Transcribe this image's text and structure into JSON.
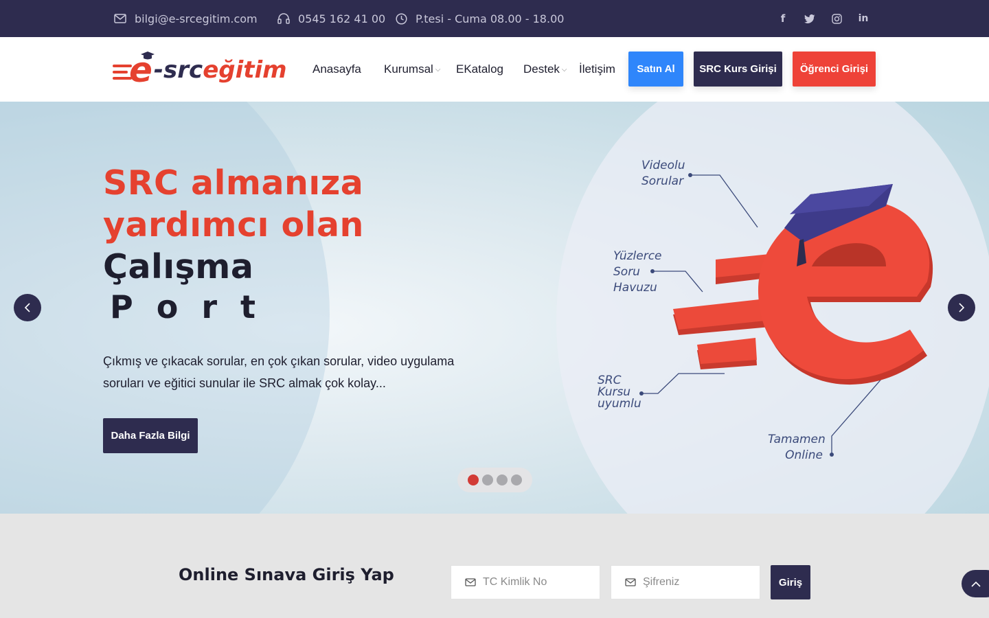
{
  "topbar": {
    "email": "bilgi@e-srcegitim.com",
    "phone": "0545 162 41 00",
    "hours": "P.tesi - Cuma 08.00 - 18.00",
    "social": [
      "facebook-icon",
      "twitter-icon",
      "instagram-icon",
      "linkedin-icon"
    ]
  },
  "logo": {
    "e": "e",
    "src": "-src",
    "egitim": "eğitim"
  },
  "nav": {
    "items": [
      {
        "label": "Anasayfa"
      },
      {
        "label": "Kurumsal"
      },
      {
        "label": "EKatalog"
      },
      {
        "label": "Destek"
      },
      {
        "label": "İletişim"
      }
    ]
  },
  "buttons": {
    "buy": "Satın Al",
    "course_login": "SRC Kurs Girişi",
    "student_login": "Öğrenci Girişi"
  },
  "hero": {
    "title_line1": "SRC almanıza",
    "title_line2": "yardımcı olan",
    "title_line3": "Çalışma",
    "typed": "Port",
    "description": "Çıkmış ve çıkacak sorular, en çok çıkan sorular, video uygulama soruları ve eğitici sunular ile SRC almak çok kolay...",
    "cta": "Daha Fazla Bilgi",
    "slides_total": 4,
    "active_slide": 1,
    "callouts": {
      "videolu": "Videolu\nSorular",
      "yuzlerce": "Yüzlerce\nSoru\nHavuzu",
      "src": "SRC\nKursu\nuyumlu",
      "online": "Tamamen\nOnline"
    }
  },
  "login": {
    "title": "Online Sınava Giriş Yap",
    "tc_placeholder": "TC Kimlik No",
    "password_placeholder": "Şifreniz",
    "submit": "Giriş"
  },
  "colors": {
    "navy": "#2e2c4f",
    "red": "#e5412f",
    "blue": "#2f86fb"
  }
}
